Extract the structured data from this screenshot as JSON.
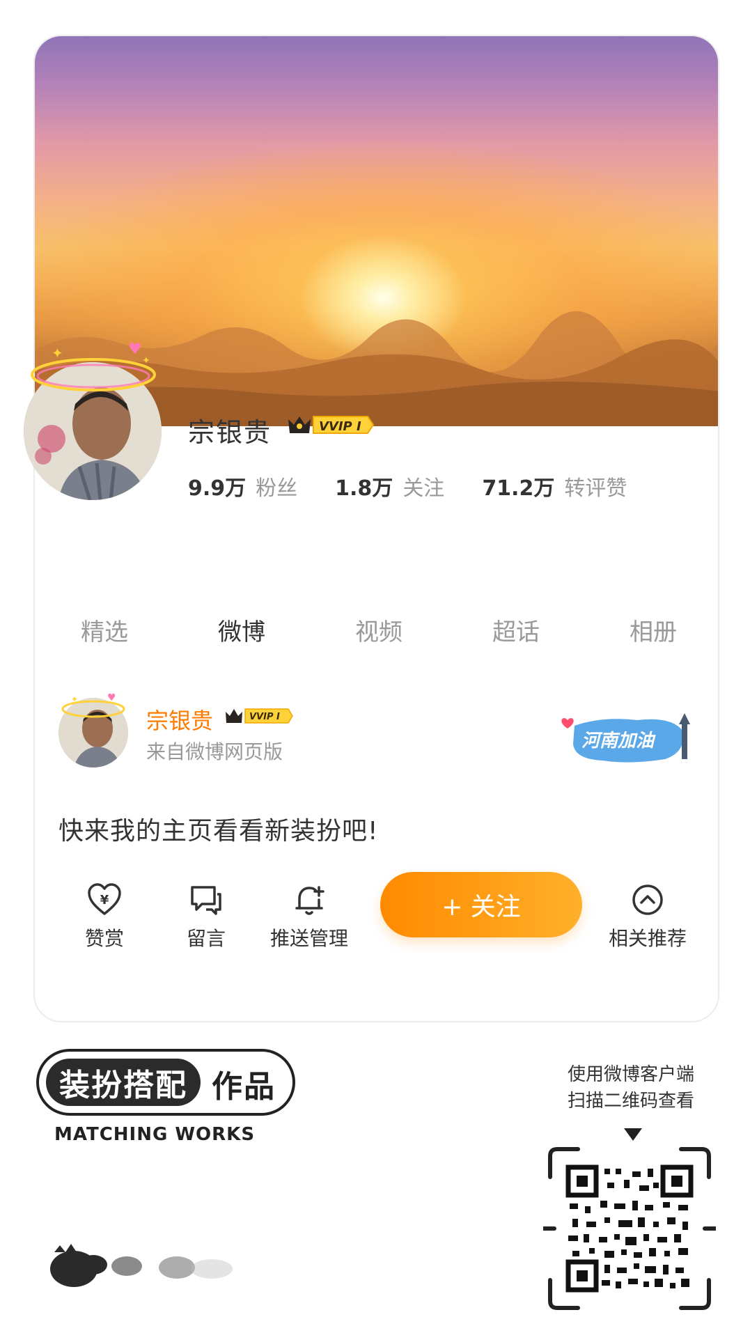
{
  "profile": {
    "name": "宗银贵",
    "vip_label": "VVIP I",
    "stats": [
      {
        "num": "9.9万",
        "label": "粉丝"
      },
      {
        "num": "1.8万",
        "label": "关注"
      },
      {
        "num": "71.2万",
        "label": "转评赞"
      }
    ]
  },
  "tabs": [
    "精选",
    "微博",
    "视频",
    "超话",
    "相册"
  ],
  "active_tab": "微博",
  "post": {
    "author": "宗银贵",
    "vip_label": "VVIP I",
    "source": "来自微博网页版",
    "badge_text": "河南加油",
    "text": "快来我的主页看看新装扮吧!"
  },
  "actions": {
    "reward": "赞赏",
    "message": "留言",
    "push": "推送管理",
    "follow": "+ 关注",
    "related": "相关推荐"
  },
  "footer": {
    "badge_main": "装扮搭配",
    "badge_side": "作品",
    "badge_en": "MATCHING WORKS",
    "qr_hint_line1": "使用微博客户端",
    "qr_hint_line2": "扫描二维码查看"
  },
  "colors": {
    "accent": "#ff8a00",
    "name_orange": "#ff7a00",
    "gray_text": "#999999"
  }
}
